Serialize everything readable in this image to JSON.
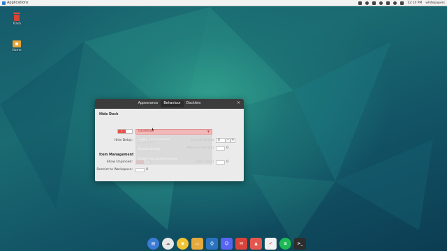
{
  "panel": {
    "menu_label": "Applications",
    "clock": "12:14 PM",
    "user": "whitepapers"
  },
  "desktop": {
    "icons": [
      {
        "label": "Trash",
        "icon": "trash-icon"
      },
      {
        "label": "Home",
        "icon": "home-folder-icon"
      }
    ]
  },
  "dialog": {
    "tabs": [
      "Appearance",
      "Behaviour",
      "Docklets"
    ],
    "active_tab": "Behaviour",
    "close_label": "×",
    "hide_dock": {
      "heading": "Hide Dock",
      "toggle_on_label": "I",
      "hide_mode_value": "Intellihide",
      "hide_delay_label": "Hide Delay:",
      "hide_delay_value": "0",
      "unhide_delay_label": "Unhide Delay:",
      "unhide_delay_value": "0",
      "pressure_reveal_label": "Pressure Reveal:"
    },
    "hide_mode_options": [
      "Dodge active window",
      "Window Dodge",
      "Dodge maximized window"
    ],
    "item_management": {
      "heading": "Item Management",
      "show_unpinned_label": "Show Unpinned:",
      "lock_icons_label": "Lock Icons:",
      "restrict_label": "Restrict to Workspace:",
      "check_off_label": "O"
    },
    "spin_minus": "−",
    "spin_plus": "+"
  },
  "dock": {
    "items": [
      {
        "name": "dock-item-files",
        "icon": "folder-icon",
        "color": "#3a7bd5"
      },
      {
        "name": "dock-item-firefox",
        "icon": "firefox-icon",
        "color": "#f0922b"
      },
      {
        "name": "dock-item-web",
        "icon": "browser-icon",
        "color": "#e0e0e0"
      },
      {
        "name": "dock-item-chrome",
        "icon": "chrome-icon",
        "color": "#f1c232"
      },
      {
        "name": "dock-item-folder",
        "icon": "yellow-folder-icon",
        "color": "#e5a93c"
      },
      {
        "name": "dock-item-vscode",
        "icon": "vscode-icon",
        "color": "#2b73c0"
      },
      {
        "name": "dock-item-discord",
        "icon": "discord-icon",
        "color": "#5865f2"
      },
      {
        "name": "dock-item-chat",
        "icon": "chat-icon",
        "color": "#d9443a"
      },
      {
        "name": "dock-item-app",
        "icon": "app-icon",
        "color": "#e2584e"
      },
      {
        "name": "dock-item-mail",
        "icon": "mail-icon",
        "color": "#e25c45"
      },
      {
        "name": "dock-item-spotify",
        "icon": "spotify-icon",
        "color": "#1db954"
      },
      {
        "name": "dock-item-terminal",
        "icon": "terminal-icon",
        "color": "#2d2d2d"
      }
    ]
  }
}
